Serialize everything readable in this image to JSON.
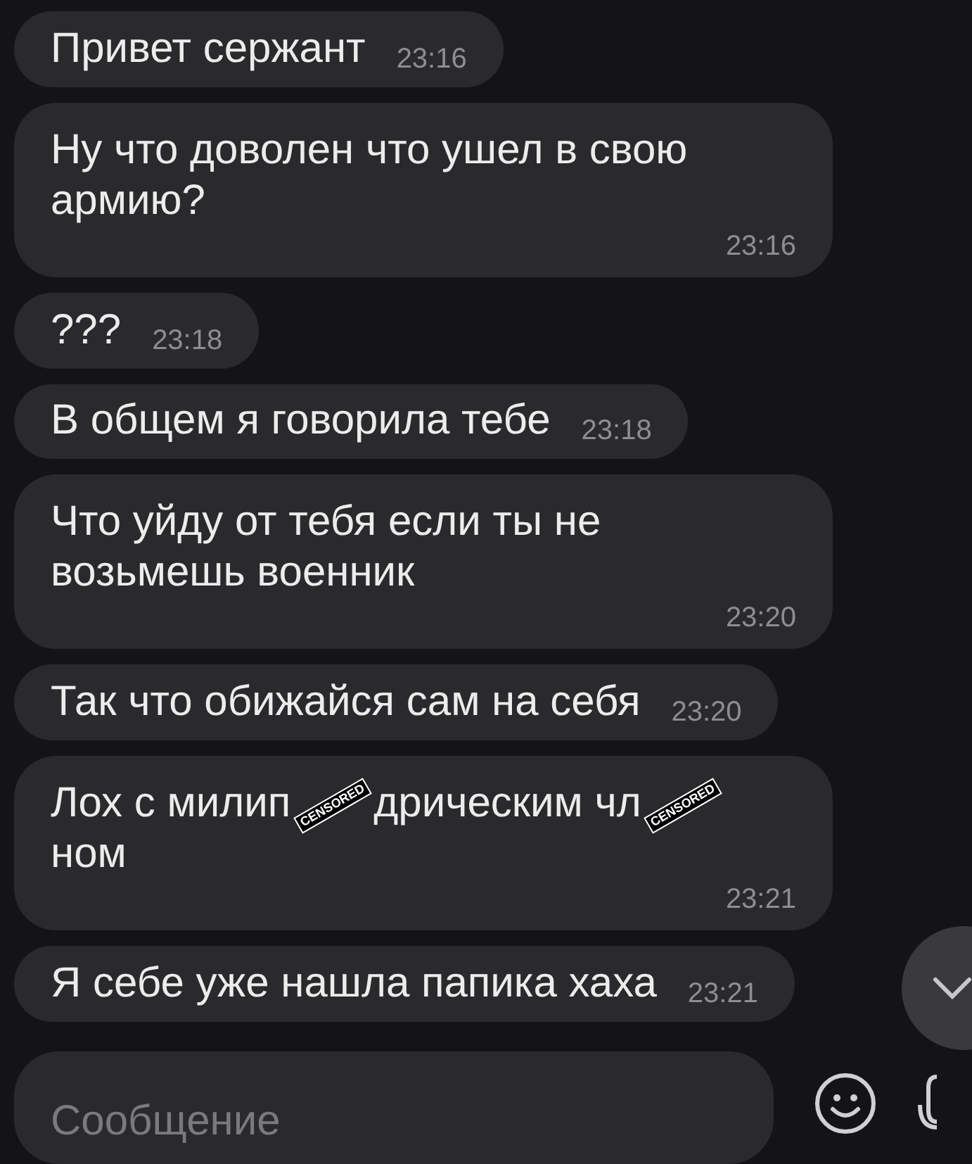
{
  "messages": [
    {
      "kind": "inline",
      "parts": [
        {
          "kind": "text",
          "text": "Привет сержант"
        }
      ],
      "time": "23:16"
    },
    {
      "kind": "multiline",
      "parts": [
        {
          "kind": "text",
          "text": "Ну что доволен что ушел в свою армию?"
        }
      ],
      "time": "23:16"
    },
    {
      "kind": "inline",
      "parts": [
        {
          "kind": "text",
          "text": "???"
        }
      ],
      "time": "23:18"
    },
    {
      "kind": "inline",
      "parts": [
        {
          "kind": "text",
          "text": "В общем я говорила тебе"
        }
      ],
      "time": "23:18"
    },
    {
      "kind": "multiline",
      "parts": [
        {
          "kind": "text",
          "text": "Что уйду от тебя если ты не возьмешь военник"
        }
      ],
      "time": "23:20"
    },
    {
      "kind": "inline",
      "parts": [
        {
          "kind": "text",
          "text": "Так что обижайся сам на себя"
        }
      ],
      "time": "23:20"
    },
    {
      "kind": "multiline",
      "parts": [
        {
          "kind": "text",
          "text": "Лох с милип"
        },
        {
          "kind": "sticker",
          "text": "CENSORED"
        },
        {
          "kind": "text",
          "text": "дрическим чл"
        },
        {
          "kind": "sticker",
          "text": "CENSORED"
        },
        {
          "kind": "text",
          "text": "ном"
        }
      ],
      "time": "23:21"
    },
    {
      "kind": "inline",
      "parts": [
        {
          "kind": "text",
          "text": "Я себе уже нашла папика хаха"
        }
      ],
      "time": "23:21"
    }
  ],
  "composer": {
    "placeholder": "Сообщение"
  }
}
